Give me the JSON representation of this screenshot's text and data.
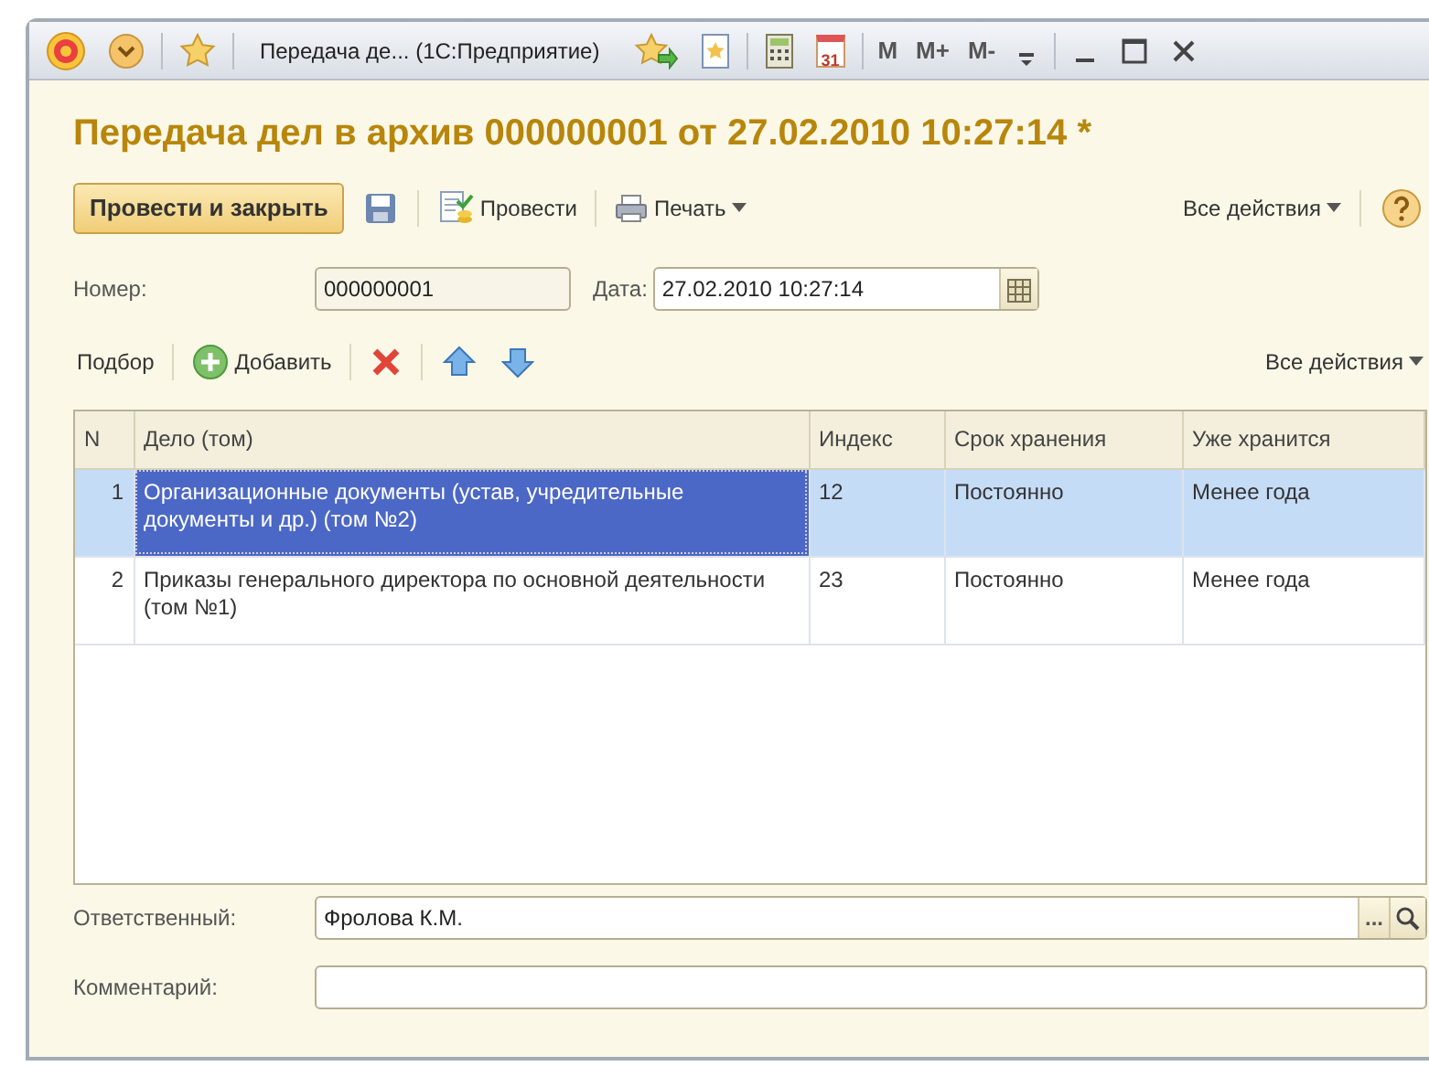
{
  "window": {
    "title": "Передача де... (1С:Предприятие)",
    "calendar_day": "31",
    "memory_keys": [
      "M",
      "M+",
      "M-"
    ]
  },
  "heading": "Передача дел в архив 000000001 от 27.02.2010 10:27:14 *",
  "toolbar": {
    "primary": "Провести и закрыть",
    "post": "Провести",
    "print": "Печать",
    "all_actions": "Все действия"
  },
  "fields": {
    "number_label": "Номер:",
    "number": "000000001",
    "date_label": "Дата:",
    "date": "27.02.2010 10:27:14"
  },
  "table_toolbar": {
    "pick": "Подбор",
    "add": "Добавить",
    "all_actions": "Все действия"
  },
  "table": {
    "columns": [
      "N",
      "Дело (том)",
      "Индекс",
      "Срок хранения",
      "Уже хранится"
    ],
    "rows": [
      {
        "selected": true,
        "cells": [
          "1",
          "Организационные документы (устав, учредительные документы и др.) (том №2)",
          "12",
          "Постоянно",
          "Менее года"
        ]
      },
      {
        "selected": false,
        "cells": [
          "2",
          "Приказы генерального директора по основной деятельности (том №1)",
          "23",
          "Постоянно",
          "Менее года"
        ]
      }
    ]
  },
  "responsible": {
    "label": "Ответственный:",
    "value": "Фролова К.М.",
    "choose": "..."
  },
  "comment": {
    "label": "Комментарий:"
  }
}
